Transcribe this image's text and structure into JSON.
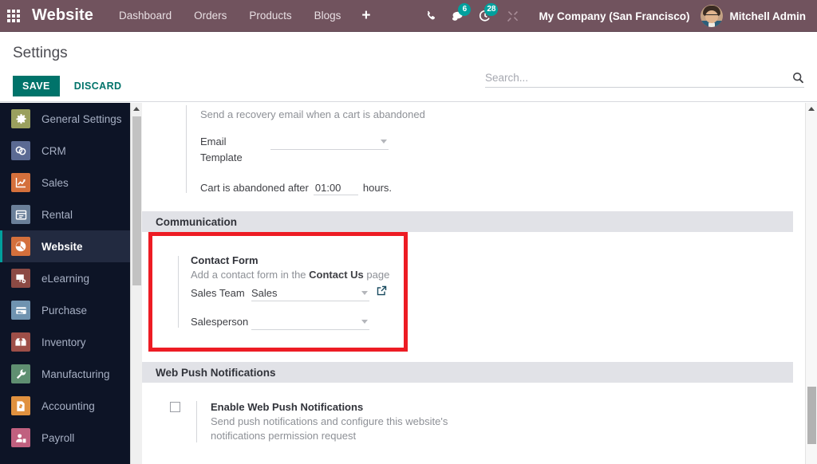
{
  "navbar": {
    "apps_icon": "apps-grid-icon",
    "brand": "Website",
    "menu": [
      {
        "label": "Dashboard"
      },
      {
        "label": "Orders"
      },
      {
        "label": "Products"
      },
      {
        "label": "Blogs"
      }
    ],
    "plus_label": "+",
    "sys_icons": [
      {
        "name": "phone-icon",
        "badge": null
      },
      {
        "name": "messages-icon",
        "badge": "6"
      },
      {
        "name": "activities-clock-icon",
        "badge": "28"
      },
      {
        "name": "developer-tools-icon",
        "badge": null
      }
    ],
    "company": "My Company (San Francisco)",
    "user": "Mitchell Admin",
    "colors": {
      "bar": "#71535e",
      "badge": "#00a09d"
    }
  },
  "controlpanel": {
    "title": "Settings",
    "save_label": "SAVE",
    "discard_label": "DISCARD",
    "search_placeholder": "Search...",
    "search_value": "",
    "search_icon": "search-icon",
    "accent": "#00736a"
  },
  "sidebar": {
    "items": [
      {
        "label": "General Settings",
        "icon": "gear-icon",
        "color": "#9aa05e",
        "active": false
      },
      {
        "label": "CRM",
        "icon": "handshake-icon",
        "color": "#5b6a93",
        "active": false
      },
      {
        "label": "Sales",
        "icon": "chart-up-icon",
        "color": "#d4703c",
        "active": false
      },
      {
        "label": "Rental",
        "icon": "calendar-icon",
        "color": "#6a7f99",
        "active": false
      },
      {
        "label": "Website",
        "icon": "globe-icon",
        "color": "#d4703c",
        "active": true
      },
      {
        "label": "eLearning",
        "icon": "presentation-icon",
        "color": "#8c4a44",
        "active": false
      },
      {
        "label": "Purchase",
        "icon": "credit-card-icon",
        "color": "#6f93b0",
        "active": false
      },
      {
        "label": "Inventory",
        "icon": "box-icon",
        "color": "#9e4f48",
        "active": false
      },
      {
        "label": "Manufacturing",
        "icon": "wrench-icon",
        "color": "#5f8f71",
        "active": false
      },
      {
        "label": "Accounting",
        "icon": "invoice-dollar-icon",
        "color": "#e0913f",
        "active": false
      },
      {
        "label": "Payroll",
        "icon": "employee-badge-icon",
        "color": "#c0607f",
        "active": false
      }
    ],
    "scrollbar": {
      "arrow_icon": "scroll-up-arrow-icon"
    }
  },
  "main": {
    "abandoned_cart": {
      "hint": "Send a recovery email when a cart is abandoned",
      "email_template_label": "Email Template",
      "email_template_value": "",
      "abandoned_prefix": "Cart is abandoned after",
      "abandoned_value": "01:00",
      "abandoned_suffix": "hours."
    },
    "sections": [
      {
        "title": "Communication"
      },
      {
        "title": "Web Push Notifications"
      }
    ],
    "contact_form": {
      "title": "Contact Form",
      "hint_before": "Add a contact form in the ",
      "hint_link": "Contact Us",
      "hint_after": " page",
      "sales_team_label": "Sales Team",
      "sales_team_value": "Sales",
      "external_link_icon": "external-link-icon",
      "salesperson_label": "Salesperson",
      "salesperson_value": "",
      "highlight_color": "#ed1c24"
    },
    "web_push": {
      "checkbox_checked": false,
      "label": "Enable Web Push Notifications",
      "hint_line1": "Send push notifications and configure this website's",
      "hint_line2": "notifications permission request"
    },
    "scrollbar": {
      "arrow_icon": "scroll-up-arrow-icon"
    }
  }
}
